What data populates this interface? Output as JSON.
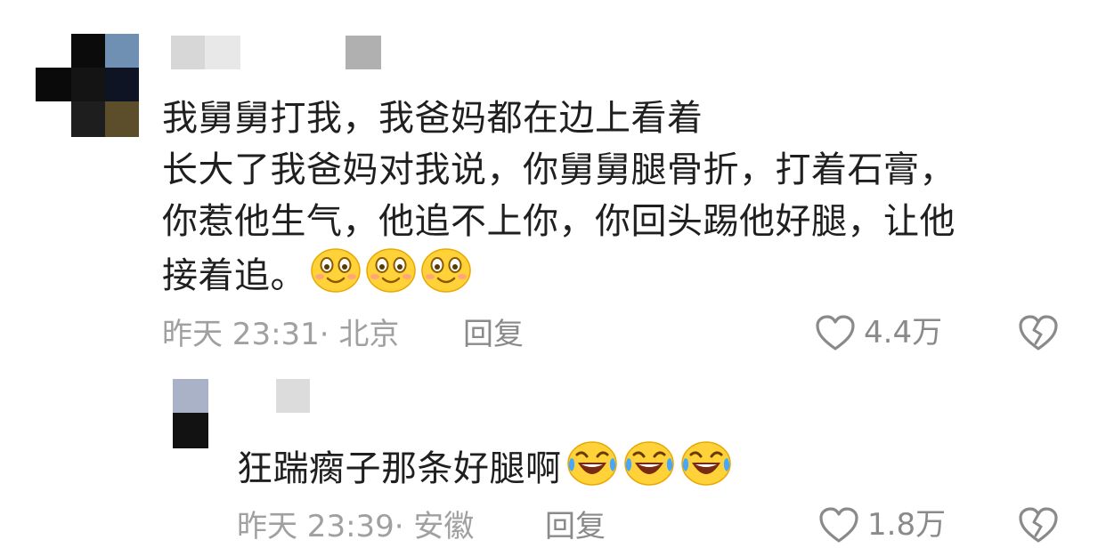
{
  "comments": [
    {
      "lines": [
        "我舅舅打我，我爸妈都在边上看着",
        "长大了我爸妈对我说，你舅舅腿骨折，打着石膏，",
        "你惹他生气，他追不上你，你回头踢他好腿，让他",
        "接着追。"
      ],
      "emojis": [
        "smile-emoji",
        "smile-emoji",
        "smile-emoji"
      ],
      "meta": "昨天 23:31· 北京",
      "reply_label": "回复",
      "like_count": "4.4万",
      "icons": {
        "like": "heart-icon",
        "dislike": "broken-heart-icon"
      }
    }
  ],
  "replies": [
    {
      "text": "狂踹瘸子那条好腿啊",
      "emojis": [
        "laugh-cry-emoji",
        "laugh-cry-emoji",
        "laugh-cry-emoji"
      ],
      "meta": "昨天 23:39· 安徽",
      "reply_label": "回复",
      "like_count": "1.8万",
      "icons": {
        "like": "heart-icon",
        "dislike": "broken-heart-icon"
      }
    }
  ],
  "colors": {
    "text": "#1f1f1f",
    "meta": "#a0a0a0",
    "action": "#8a8a8a",
    "emoji_face": "#ffd23a"
  }
}
